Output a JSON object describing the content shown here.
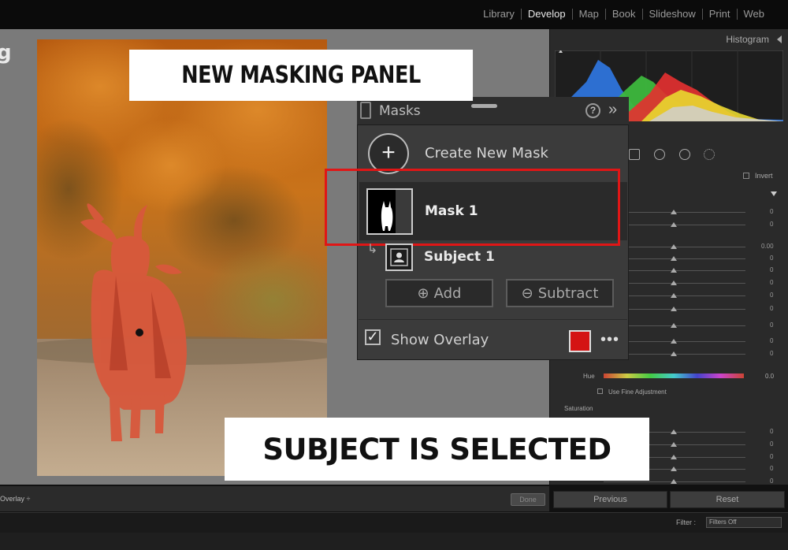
{
  "top_nav": {
    "modules": [
      "Library",
      "Develop",
      "Map",
      "Book",
      "Slideshow",
      "Print",
      "Web"
    ],
    "active": "Develop"
  },
  "left_edge_text": "g",
  "callouts": {
    "top": "NEW MASKING PANEL",
    "bottom": "SUBJECT IS SELECTED"
  },
  "right_panel": {
    "histogram_title": "Histogram",
    "invert_label": "Invert",
    "hue_label": "Hue",
    "hue_value": "0.0",
    "fine_adjustment_label": "Use Fine Adjustment",
    "saturation_label": "Saturation",
    "slider_values": [
      "0",
      "0",
      "0.00",
      "0",
      "0",
      "0",
      "0",
      "0",
      "0",
      "0",
      "0",
      "0",
      "0",
      "0",
      "0",
      "0"
    ]
  },
  "masks_panel": {
    "title": "Masks",
    "help_icon": "?",
    "collapse_icon": "»",
    "create_label": "Create New Mask",
    "mask1_label": "Mask 1",
    "subject_label": "Subject 1",
    "add_label": "Add",
    "subtract_label": "Subtract",
    "show_overlay_label": "Show Overlay",
    "overlay_checked": true,
    "overlay_color": "#d41414",
    "more_icon": "•••"
  },
  "bottom": {
    "overlay_label": "Overlay ÷",
    "done_label": "Done",
    "previous_label": "Previous",
    "reset_label": "Reset",
    "filter_label": "Filter :",
    "filter_value": "Filters Off"
  },
  "colors": {
    "mask_red": "#d41414",
    "highlight_frame": "#e01616",
    "panel_bg": "#3b3b3b"
  }
}
